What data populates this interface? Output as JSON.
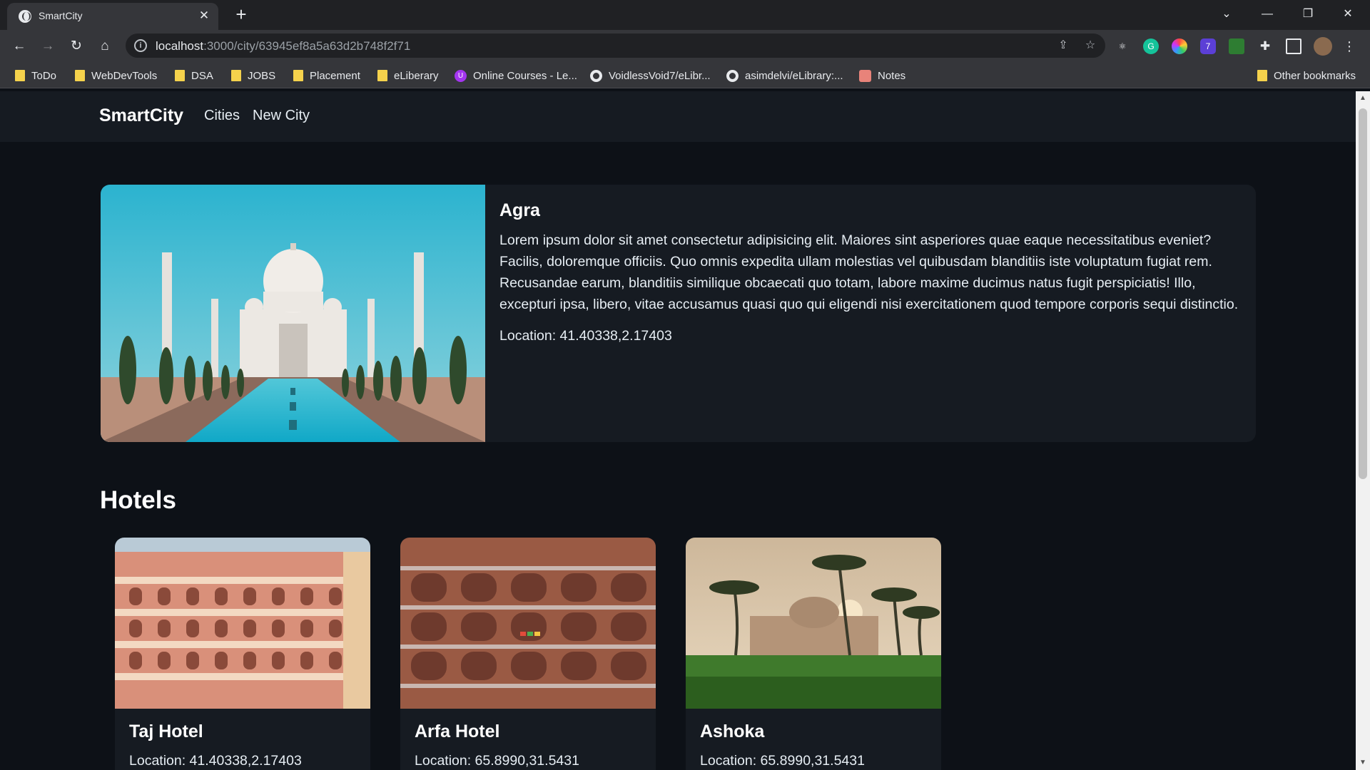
{
  "browser": {
    "tab_title": "SmartCity",
    "url_host": "localhost",
    "url_path": ":3000/city/63945ef8a5a63d2b748f2f71",
    "extension_badge": "7",
    "bookmarks": [
      "ToDo",
      "WebDevTools",
      "DSA",
      "JOBS",
      "Placement",
      "eLiberary",
      "Online Courses - Le...",
      "VoidlessVoid7/eLibr...",
      "asimdelvi/eLibrary:...",
      "Notes"
    ],
    "other_bookmarks": "Other bookmarks"
  },
  "navbar": {
    "brand": "SmartCity",
    "links": [
      "Cities",
      "New City"
    ]
  },
  "city": {
    "name": "Agra",
    "description": "Lorem ipsum dolor sit amet consectetur adipisicing elit. Maiores sint asperiores quae eaque necessitatibus eveniet? Facilis, doloremque officiis. Quo omnis expedita ullam molestias vel quibusdam blanditiis iste voluptatum fugiat rem. Recusandae earum, blanditiis similique obcaecati quo totam, labore maxime ducimus natus fugit perspiciatis! Illo, excepturi ipsa, libero, vitae accusamus quasi quo qui eligendi nisi exercitationem quod tempore corporis sequi distinctio.",
    "location": "Location: 41.40338,2.17403"
  },
  "hotels_heading": "Hotels",
  "hotels": [
    {
      "name": "Taj Hotel",
      "location": "Location: 41.40338,2.17403"
    },
    {
      "name": "Arfa Hotel",
      "location": "Location: 65.8990,31.5431"
    },
    {
      "name": "Ashoka",
      "location": "Location: 65.8990,31.5431"
    }
  ]
}
